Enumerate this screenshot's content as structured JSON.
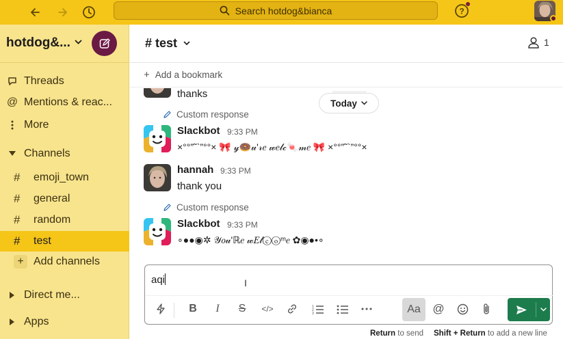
{
  "topbar": {
    "search_placeholder": "Search hotdog&bianca",
    "colors": {
      "background": "#f5c518",
      "accent": "#6b1a44"
    }
  },
  "sidebar": {
    "workspace_name": "hotdog&...",
    "nav": [
      {
        "label": "Threads",
        "icon": "threads-icon"
      },
      {
        "label": "Mentions & reac...",
        "icon": "at-icon"
      },
      {
        "label": "More",
        "icon": "more-vertical-icon"
      }
    ],
    "channels_label": "Channels",
    "channels": [
      {
        "name": "emoji_town",
        "active": false
      },
      {
        "name": "general",
        "active": false
      },
      {
        "name": "random",
        "active": false
      },
      {
        "name": "test",
        "active": true
      }
    ],
    "add_channels_label": "Add channels",
    "direct_messages_label": "Direct me...",
    "apps_label": "Apps"
  },
  "channel": {
    "name": "# test",
    "member_count": "1",
    "bookmark_label": "Add a bookmark",
    "date_divider": "Today"
  },
  "messages": [
    {
      "type": "tail",
      "text": "thanks"
    },
    {
      "type": "custom_response",
      "label": "Custom response"
    },
    {
      "type": "message",
      "sender": "Slackbot",
      "time": "9:33 PM",
      "text": "×°°”˜`”°°×  🎀  𝓎🍩𝓊'𝓇𝑒 𝓌𝑒𝓁𝒸🍬𝓂𝑒  🎀  ×°°”˜`”°°×"
    },
    {
      "type": "message",
      "sender": "hannah",
      "time": "9:33 PM",
      "text": "thank you"
    },
    {
      "type": "custom_response",
      "label": "Custom response"
    },
    {
      "type": "message",
      "sender": "Slackbot",
      "time": "9:33 PM",
      "text": "∘●●◉✲ 𝒴𝑜𝓊'ℝ𝑒 𝓌𝐸𝓁ⓒⓞᵐ𝑒 ✿◉●•∘"
    }
  ],
  "composer": {
    "value": "aqi",
    "send_hint_key": "Return",
    "send_hint_text": "to send",
    "newline_hint_key": "Shift + Return",
    "newline_hint_text": "to add a new line",
    "format_label": "Aa",
    "send_color": "#1c7c4c"
  }
}
